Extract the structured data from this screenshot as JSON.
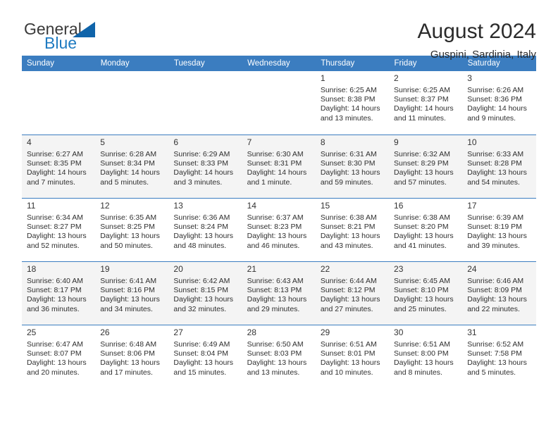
{
  "brand": {
    "name_part1": "General",
    "name_part2": "Blue"
  },
  "header": {
    "title": "August 2024",
    "location": "Guspini, Sardinia, Italy"
  },
  "colors": {
    "header_blue": "#3b7dc0",
    "logo_blue": "#1f7bc1",
    "row_alt": "#f4f4f4"
  },
  "calendar": {
    "weekday_headers": [
      "Sunday",
      "Monday",
      "Tuesday",
      "Wednesday",
      "Thursday",
      "Friday",
      "Saturday"
    ],
    "weeks": [
      [
        {
          "day": "",
          "lines": []
        },
        {
          "day": "",
          "lines": []
        },
        {
          "day": "",
          "lines": []
        },
        {
          "day": "",
          "lines": []
        },
        {
          "day": "1",
          "lines": [
            "Sunrise: 6:25 AM",
            "Sunset: 8:38 PM",
            "Daylight: 14 hours",
            "and 13 minutes."
          ]
        },
        {
          "day": "2",
          "lines": [
            "Sunrise: 6:25 AM",
            "Sunset: 8:37 PM",
            "Daylight: 14 hours",
            "and 11 minutes."
          ]
        },
        {
          "day": "3",
          "lines": [
            "Sunrise: 6:26 AM",
            "Sunset: 8:36 PM",
            "Daylight: 14 hours",
            "and 9 minutes."
          ]
        }
      ],
      [
        {
          "day": "4",
          "lines": [
            "Sunrise: 6:27 AM",
            "Sunset: 8:35 PM",
            "Daylight: 14 hours",
            "and 7 minutes."
          ]
        },
        {
          "day": "5",
          "lines": [
            "Sunrise: 6:28 AM",
            "Sunset: 8:34 PM",
            "Daylight: 14 hours",
            "and 5 minutes."
          ]
        },
        {
          "day": "6",
          "lines": [
            "Sunrise: 6:29 AM",
            "Sunset: 8:33 PM",
            "Daylight: 14 hours",
            "and 3 minutes."
          ]
        },
        {
          "day": "7",
          "lines": [
            "Sunrise: 6:30 AM",
            "Sunset: 8:31 PM",
            "Daylight: 14 hours",
            "and 1 minute."
          ]
        },
        {
          "day": "8",
          "lines": [
            "Sunrise: 6:31 AM",
            "Sunset: 8:30 PM",
            "Daylight: 13 hours",
            "and 59 minutes."
          ]
        },
        {
          "day": "9",
          "lines": [
            "Sunrise: 6:32 AM",
            "Sunset: 8:29 PM",
            "Daylight: 13 hours",
            "and 57 minutes."
          ]
        },
        {
          "day": "10",
          "lines": [
            "Sunrise: 6:33 AM",
            "Sunset: 8:28 PM",
            "Daylight: 13 hours",
            "and 54 minutes."
          ]
        }
      ],
      [
        {
          "day": "11",
          "lines": [
            "Sunrise: 6:34 AM",
            "Sunset: 8:27 PM",
            "Daylight: 13 hours",
            "and 52 minutes."
          ]
        },
        {
          "day": "12",
          "lines": [
            "Sunrise: 6:35 AM",
            "Sunset: 8:25 PM",
            "Daylight: 13 hours",
            "and 50 minutes."
          ]
        },
        {
          "day": "13",
          "lines": [
            "Sunrise: 6:36 AM",
            "Sunset: 8:24 PM",
            "Daylight: 13 hours",
            "and 48 minutes."
          ]
        },
        {
          "day": "14",
          "lines": [
            "Sunrise: 6:37 AM",
            "Sunset: 8:23 PM",
            "Daylight: 13 hours",
            "and 46 minutes."
          ]
        },
        {
          "day": "15",
          "lines": [
            "Sunrise: 6:38 AM",
            "Sunset: 8:21 PM",
            "Daylight: 13 hours",
            "and 43 minutes."
          ]
        },
        {
          "day": "16",
          "lines": [
            "Sunrise: 6:38 AM",
            "Sunset: 8:20 PM",
            "Daylight: 13 hours",
            "and 41 minutes."
          ]
        },
        {
          "day": "17",
          "lines": [
            "Sunrise: 6:39 AM",
            "Sunset: 8:19 PM",
            "Daylight: 13 hours",
            "and 39 minutes."
          ]
        }
      ],
      [
        {
          "day": "18",
          "lines": [
            "Sunrise: 6:40 AM",
            "Sunset: 8:17 PM",
            "Daylight: 13 hours",
            "and 36 minutes."
          ]
        },
        {
          "day": "19",
          "lines": [
            "Sunrise: 6:41 AM",
            "Sunset: 8:16 PM",
            "Daylight: 13 hours",
            "and 34 minutes."
          ]
        },
        {
          "day": "20",
          "lines": [
            "Sunrise: 6:42 AM",
            "Sunset: 8:15 PM",
            "Daylight: 13 hours",
            "and 32 minutes."
          ]
        },
        {
          "day": "21",
          "lines": [
            "Sunrise: 6:43 AM",
            "Sunset: 8:13 PM",
            "Daylight: 13 hours",
            "and 29 minutes."
          ]
        },
        {
          "day": "22",
          "lines": [
            "Sunrise: 6:44 AM",
            "Sunset: 8:12 PM",
            "Daylight: 13 hours",
            "and 27 minutes."
          ]
        },
        {
          "day": "23",
          "lines": [
            "Sunrise: 6:45 AM",
            "Sunset: 8:10 PM",
            "Daylight: 13 hours",
            "and 25 minutes."
          ]
        },
        {
          "day": "24",
          "lines": [
            "Sunrise: 6:46 AM",
            "Sunset: 8:09 PM",
            "Daylight: 13 hours",
            "and 22 minutes."
          ]
        }
      ],
      [
        {
          "day": "25",
          "lines": [
            "Sunrise: 6:47 AM",
            "Sunset: 8:07 PM",
            "Daylight: 13 hours",
            "and 20 minutes."
          ]
        },
        {
          "day": "26",
          "lines": [
            "Sunrise: 6:48 AM",
            "Sunset: 8:06 PM",
            "Daylight: 13 hours",
            "and 17 minutes."
          ]
        },
        {
          "day": "27",
          "lines": [
            "Sunrise: 6:49 AM",
            "Sunset: 8:04 PM",
            "Daylight: 13 hours",
            "and 15 minutes."
          ]
        },
        {
          "day": "28",
          "lines": [
            "Sunrise: 6:50 AM",
            "Sunset: 8:03 PM",
            "Daylight: 13 hours",
            "and 13 minutes."
          ]
        },
        {
          "day": "29",
          "lines": [
            "Sunrise: 6:51 AM",
            "Sunset: 8:01 PM",
            "Daylight: 13 hours",
            "and 10 minutes."
          ]
        },
        {
          "day": "30",
          "lines": [
            "Sunrise: 6:51 AM",
            "Sunset: 8:00 PM",
            "Daylight: 13 hours",
            "and 8 minutes."
          ]
        },
        {
          "day": "31",
          "lines": [
            "Sunrise: 6:52 AM",
            "Sunset: 7:58 PM",
            "Daylight: 13 hours",
            "and 5 minutes."
          ]
        }
      ]
    ]
  }
}
